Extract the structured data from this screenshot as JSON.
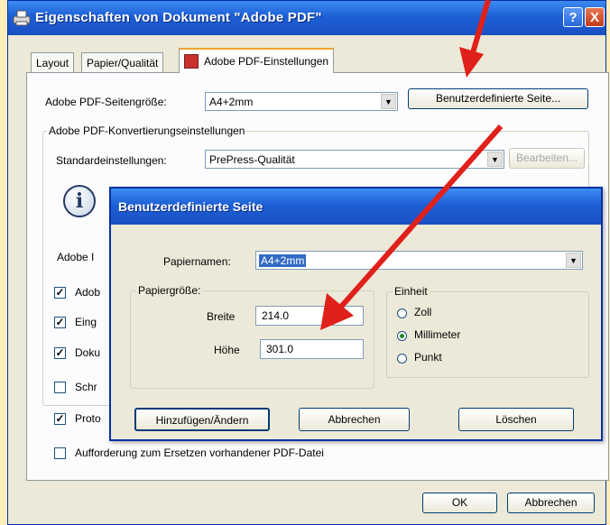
{
  "window": {
    "title": "Eigenschaften von Dokument \"Adobe PDF\"",
    "help_label": "?",
    "close_label": "X"
  },
  "tabs": [
    {
      "label": "Layout"
    },
    {
      "label": "Papier/Qualität"
    },
    {
      "label": "Adobe PDF-Einstellungen"
    }
  ],
  "panel": {
    "page_size_label": "Adobe PDF-Seitengröße:",
    "page_size_value": "A4+2mm",
    "custom_page_button": "Benutzerdefinierte Seite...",
    "conversion_group_title": "Adobe PDF-Konvertierungseinstellungen",
    "standard_label": "Standardeinstellungen:",
    "standard_value": "PrePress-Qualität",
    "edit_button": "Bearbeiten...",
    "adobe_label_partial": "Adobe I",
    "checkbox_rows": [
      {
        "label": "Adob",
        "checked": true
      },
      {
        "label": "Eing",
        "checked": true
      },
      {
        "label": "Doku",
        "checked": true
      },
      {
        "label": "Schr",
        "checked": false
      },
      {
        "label": "Proto",
        "checked": true
      }
    ],
    "replace_checkbox_label": "Aufforderung zum Ersetzen vorhandener PDF-Datei",
    "ok_button": "OK",
    "cancel_button": "Abbrechen"
  },
  "dialog": {
    "title": "Benutzerdefinierte Seite",
    "paper_name_label": "Papiernamen:",
    "paper_name_value": "A4+2mm",
    "size_group_title": "Papiergröße:",
    "width_label": "Breite",
    "width_value": "214.0",
    "height_label": "Höhe",
    "height_value": "301.0",
    "unit_group_title": "Einheit",
    "units": [
      {
        "label": "Zoll",
        "selected": false
      },
      {
        "label": "Millimeter",
        "selected": true
      },
      {
        "label": "Punkt",
        "selected": false
      }
    ],
    "add_change_button": "Hinzufügen/Ändern",
    "cancel_button": "Abbrechen",
    "delete_button": "Löschen"
  },
  "colors": {
    "background": "#fdeeb9",
    "titlebar": "#1d5fd6",
    "annotation_arrow": "#e0201a"
  }
}
